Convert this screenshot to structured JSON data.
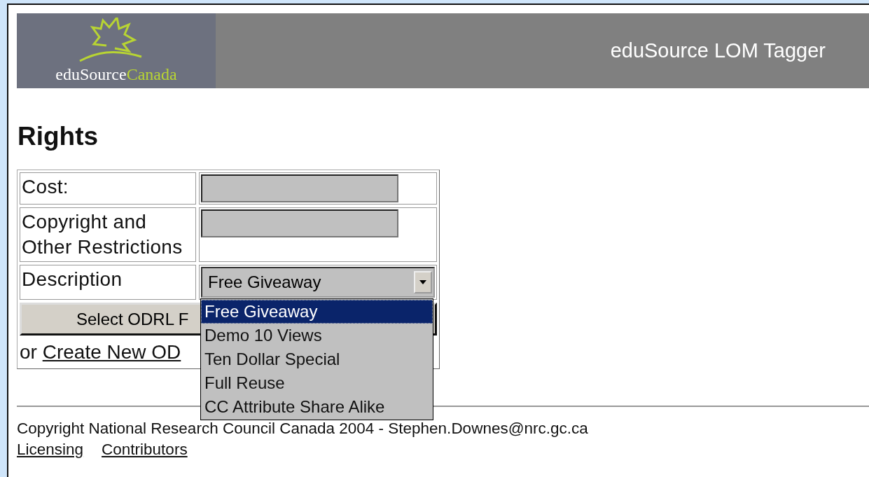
{
  "header": {
    "logo": {
      "first": "eduSource",
      "second": "Canada"
    },
    "title": "eduSource LOM Tagger"
  },
  "heading": "Rights",
  "form": {
    "rows": [
      {
        "kind": "input",
        "label": "Cost:"
      },
      {
        "kind": "input",
        "label": "Copyright and Other Restrictions"
      },
      {
        "kind": "select",
        "label": "Description",
        "value": "Free Giveaway",
        "expanded": true,
        "options": [
          {
            "label": "Free Giveaway",
            "selected": true
          },
          {
            "label": "Demo 10 Views",
            "selected": false
          },
          {
            "label": "Ten Dollar Special",
            "selected": false
          },
          {
            "label": "Full Reuse",
            "selected": false
          },
          {
            "label": "CC Attribute Share Alike",
            "selected": false
          }
        ]
      }
    ],
    "button": "Select ODRL F",
    "link_prefix": "or",
    "link": "Create New OD"
  },
  "footer": {
    "text": "Copyright National Research Council Canada 2004 - Stephen.Downes@nrc.gc.ca",
    "links": [
      "Licensing",
      "Contributors"
    ]
  }
}
